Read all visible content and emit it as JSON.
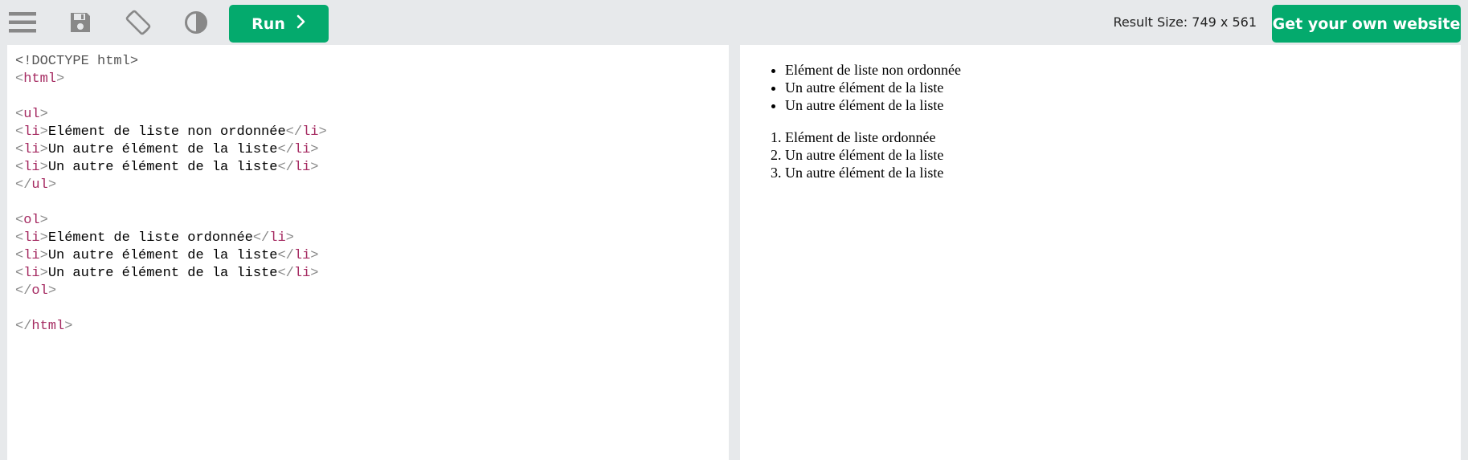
{
  "toolbar": {
    "icons": {
      "menu": "menu-icon",
      "save": "save-icon",
      "rotate": "rotate-icon",
      "theme": "contrast-icon"
    },
    "run_label": "Run",
    "result_size_label": "Result Size: 749 x 561",
    "get_website_label": "Get your own website"
  },
  "colors": {
    "accent": "#04aa6d",
    "toolbar_bg": "#e7e9eb",
    "tag": "#a52a61",
    "bracket": "#888888"
  },
  "code": {
    "doctype": "<!DOCTYPE html>",
    "lines": [
      {
        "tag": "html",
        "close": false
      },
      {},
      {
        "tag": "ul",
        "close": false
      },
      {
        "tag": "li",
        "text": "Elément de liste non ordonnée"
      },
      {
        "tag": "li",
        "text": "Un autre élément de la liste"
      },
      {
        "tag": "li",
        "text": "Un autre élément de la liste"
      },
      {
        "tag": "ul",
        "close": true
      },
      {},
      {
        "tag": "ol",
        "close": false
      },
      {
        "tag": "li",
        "text": "Elément de liste ordonnée"
      },
      {
        "tag": "li",
        "text": "Un autre élément de la liste"
      },
      {
        "tag": "li",
        "text": "Un autre élément de la liste"
      },
      {
        "tag": "ol",
        "close": true
      },
      {},
      {
        "tag": "html",
        "close": true
      }
    ]
  },
  "result": {
    "unordered": [
      "Elément de liste non ordonnée",
      "Un autre élément de la liste",
      "Un autre élément de la liste"
    ],
    "ordered": [
      "Elément de liste ordonnée",
      "Un autre élément de la liste",
      "Un autre élément de la liste"
    ]
  }
}
